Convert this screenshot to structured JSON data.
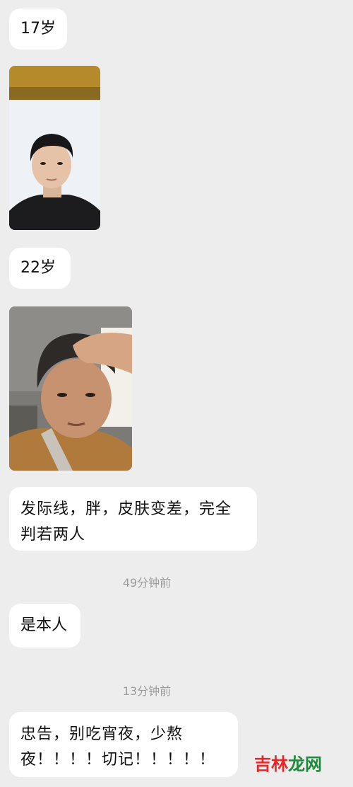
{
  "messages": [
    {
      "type": "text",
      "text": "17岁"
    },
    {
      "type": "image",
      "alt": "17-year-old ID photo"
    },
    {
      "type": "text",
      "text": "22岁"
    },
    {
      "type": "image",
      "alt": "22-year-old selfie"
    },
    {
      "type": "text",
      "lines": [
        "发际线，胖，皮肤变差，完全",
        "判若两人"
      ]
    },
    {
      "type": "time",
      "text": "49分钟前"
    },
    {
      "type": "text",
      "text": "是本人"
    },
    {
      "type": "time",
      "text": "13分钟前"
    },
    {
      "type": "text",
      "lines": [
        "忠告，别吃宵夜，少熬",
        "夜！！！！切记！！！！！"
      ]
    }
  ],
  "watermark": {
    "part1": "吉林",
    "part2": "龙网"
  },
  "colors": {
    "background": "#ededed",
    "bubble": "#ffffff",
    "timestamp": "#9b9b9b",
    "watermark_red": "#e8262a",
    "watermark_green": "#1f8a3a"
  }
}
